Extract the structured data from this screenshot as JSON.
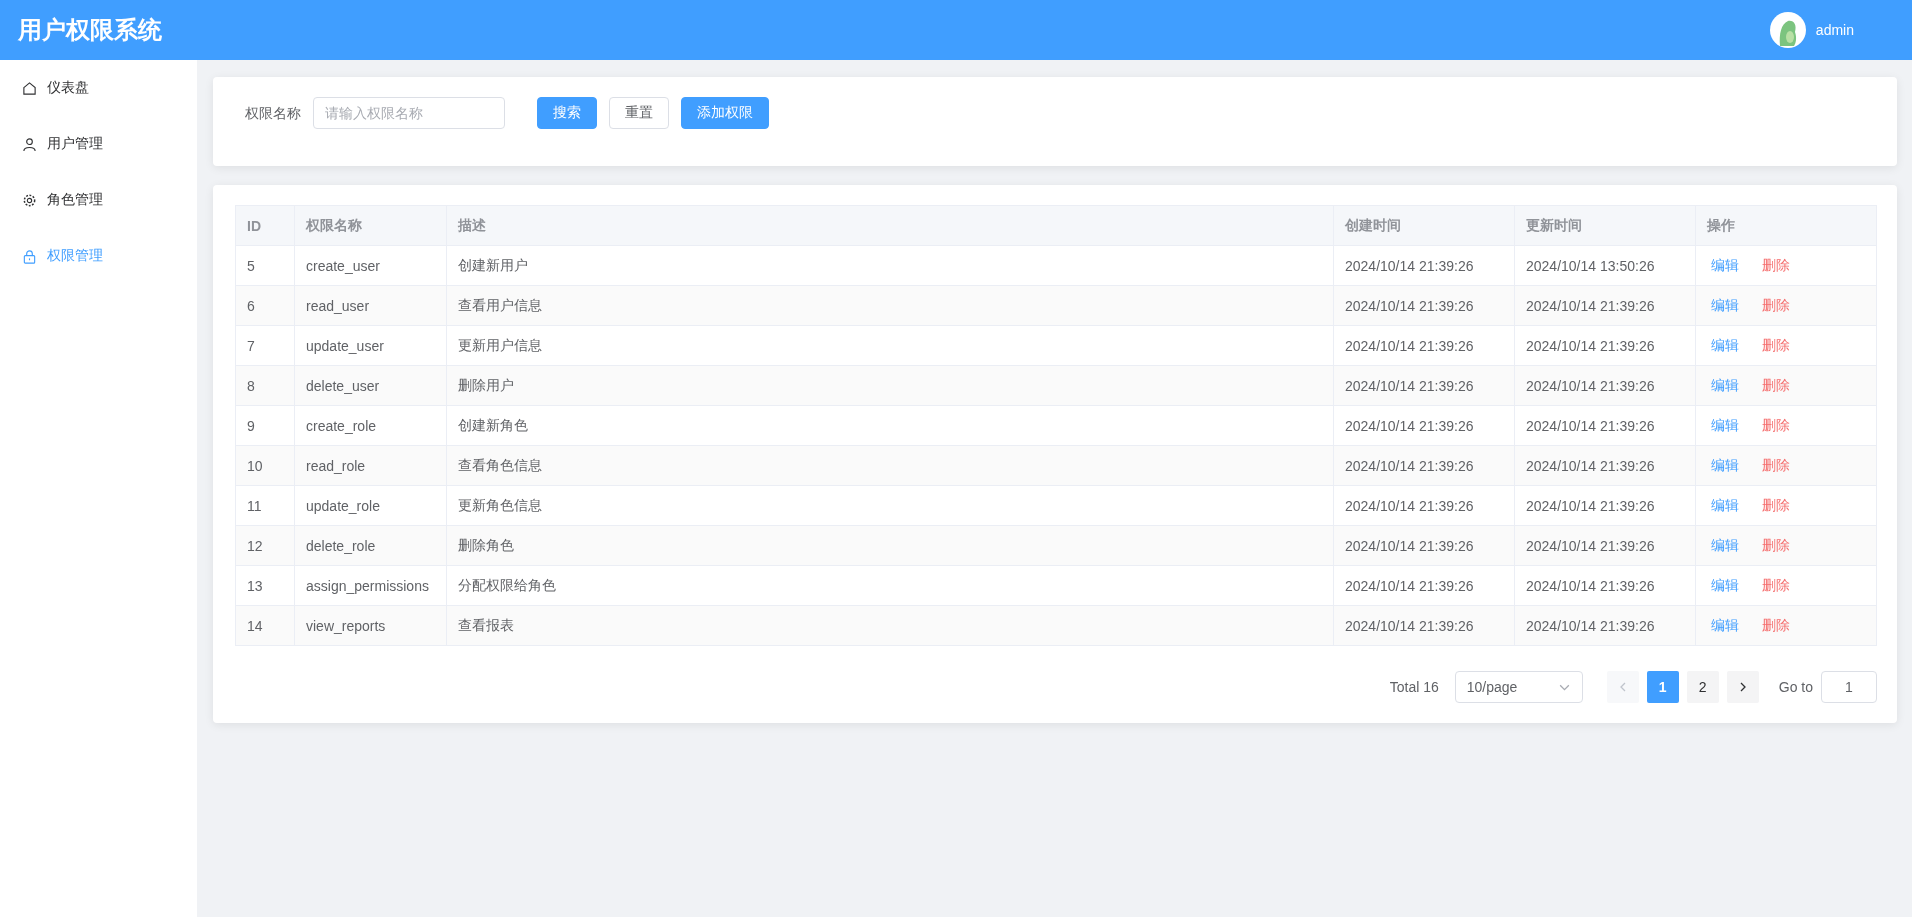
{
  "header": {
    "title": "用户权限系统",
    "user": "admin"
  },
  "sidebar": {
    "items": [
      {
        "label": "仪表盘",
        "selected": false
      },
      {
        "label": "用户管理",
        "selected": false
      },
      {
        "label": "角色管理",
        "selected": false
      },
      {
        "label": "权限管理",
        "selected": true
      }
    ]
  },
  "search": {
    "label": "权限名称",
    "placeholder": "请输入权限名称",
    "buttons": [
      {
        "label": "搜索",
        "kind": "primary"
      },
      {
        "label": "重置",
        "kind": "plain"
      },
      {
        "label": "添加权限",
        "kind": "primary"
      }
    ]
  },
  "table": {
    "columns": [
      "ID",
      "权限名称",
      "描述",
      "创建时间",
      "更新时间",
      "操作"
    ],
    "rows": [
      {
        "cells": [
          "5",
          "create_user",
          "创建新用户",
          "2024/10/14 21:39:26",
          "2024/10/14 13:50:26"
        ],
        "actions": [
          "编辑",
          "删除"
        ]
      },
      {
        "cells": [
          "6",
          "read_user",
          "查看用户信息",
          "2024/10/14 21:39:26",
          "2024/10/14 21:39:26"
        ],
        "actions": [
          "编辑",
          "删除"
        ]
      },
      {
        "cells": [
          "7",
          "update_user",
          "更新用户信息",
          "2024/10/14 21:39:26",
          "2024/10/14 21:39:26"
        ],
        "actions": [
          "编辑",
          "删除"
        ]
      },
      {
        "cells": [
          "8",
          "delete_user",
          "删除用户",
          "2024/10/14 21:39:26",
          "2024/10/14 21:39:26"
        ],
        "actions": [
          "编辑",
          "删除"
        ]
      },
      {
        "cells": [
          "9",
          "create_role",
          "创建新角色",
          "2024/10/14 21:39:26",
          "2024/10/14 21:39:26"
        ],
        "actions": [
          "编辑",
          "删除"
        ]
      },
      {
        "cells": [
          "10",
          "read_role",
          "查看角色信息",
          "2024/10/14 21:39:26",
          "2024/10/14 21:39:26"
        ],
        "actions": [
          "编辑",
          "删除"
        ]
      },
      {
        "cells": [
          "11",
          "update_role",
          "更新角色信息",
          "2024/10/14 21:39:26",
          "2024/10/14 21:39:26"
        ],
        "actions": [
          "编辑",
          "删除"
        ]
      },
      {
        "cells": [
          "12",
          "delete_role",
          "删除角色",
          "2024/10/14 21:39:26",
          "2024/10/14 21:39:26"
        ],
        "actions": [
          "编辑",
          "删除"
        ]
      },
      {
        "cells": [
          "13",
          "assign_permissions",
          "分配权限给角色",
          "2024/10/14 21:39:26",
          "2024/10/14 21:39:26"
        ],
        "actions": [
          "编辑",
          "删除"
        ]
      },
      {
        "cells": [
          "14",
          "view_reports",
          "查看报表",
          "2024/10/14 21:39:26",
          "2024/10/14 21:39:26"
        ],
        "actions": [
          "编辑",
          "删除"
        ]
      }
    ]
  },
  "pagination": {
    "total": "Total 16",
    "page_size": "10/page",
    "pages": [
      {
        "label": "1",
        "selected": true
      },
      {
        "label": "2",
        "selected": false
      }
    ],
    "goto_label": "Go to",
    "goto_value": "1"
  }
}
